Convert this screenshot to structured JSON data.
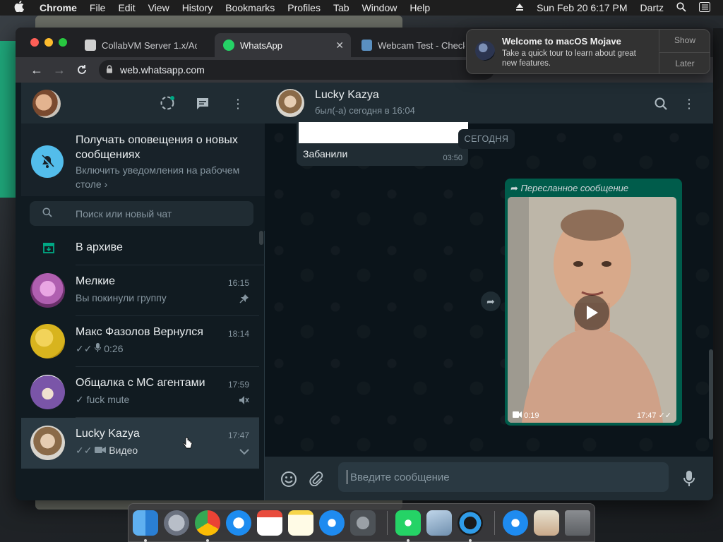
{
  "menubar": {
    "app_name": "Chrome",
    "menus": [
      "File",
      "Edit",
      "View",
      "History",
      "Bookmarks",
      "Profiles",
      "Tab",
      "Window",
      "Help"
    ],
    "datetime": "Sun Feb 20  6:17 PM",
    "user": "Dartz"
  },
  "browser": {
    "tabs": [
      {
        "title": "CollabVM Server 1.x/Ac",
        "active": false
      },
      {
        "title": "WhatsApp",
        "active": true
      },
      {
        "title": "Webcam Test - Check",
        "active": false
      }
    ],
    "url": "web.whatsapp.com"
  },
  "notification": {
    "title": "Welcome to macOS Mojave",
    "body": "Take a quick tour to learn about great new features.",
    "show_label": "Show",
    "later_label": "Later"
  },
  "sidebar": {
    "notify_title": "Получать оповещения о новых сообщениях",
    "notify_sub": "Включить уведомления на рабочем столе ›",
    "search_placeholder": "Поиск или новый чат",
    "archive_label": "В архиве",
    "chats": [
      {
        "name": "Мелкие",
        "time": "16:15",
        "preview": "Вы покинули группу",
        "avatar_color": "#b05fb0"
      },
      {
        "name": "Макс Фазолов Вернулся",
        "time": "18:14",
        "preview": "0:26",
        "avatar_color": "#d8b41e"
      },
      {
        "name": "Общалка с МС агентами",
        "time": "17:59",
        "preview": "fuck mute",
        "avatar_color": "#7a55a8"
      },
      {
        "name": "Lucky Kazya",
        "time": "17:47",
        "preview": "Видео",
        "avatar_color": "#8a8478"
      }
    ]
  },
  "conversation": {
    "contact_name": "Lucky Kazya",
    "last_seen": "был(-а) сегодня в 16:04",
    "date_chip": "СЕГОДНЯ",
    "incoming_text": "Забанили",
    "incoming_time": "03:50",
    "forwarded_label": "Пересланное сообщение",
    "video_duration": "0:19",
    "video_time": "17:47",
    "compose_placeholder": "Введите сообщение"
  },
  "colors": {
    "accent": "#00a884",
    "bubble_out": "#005c4b",
    "panel": "#202c33",
    "bg": "#111b21"
  }
}
